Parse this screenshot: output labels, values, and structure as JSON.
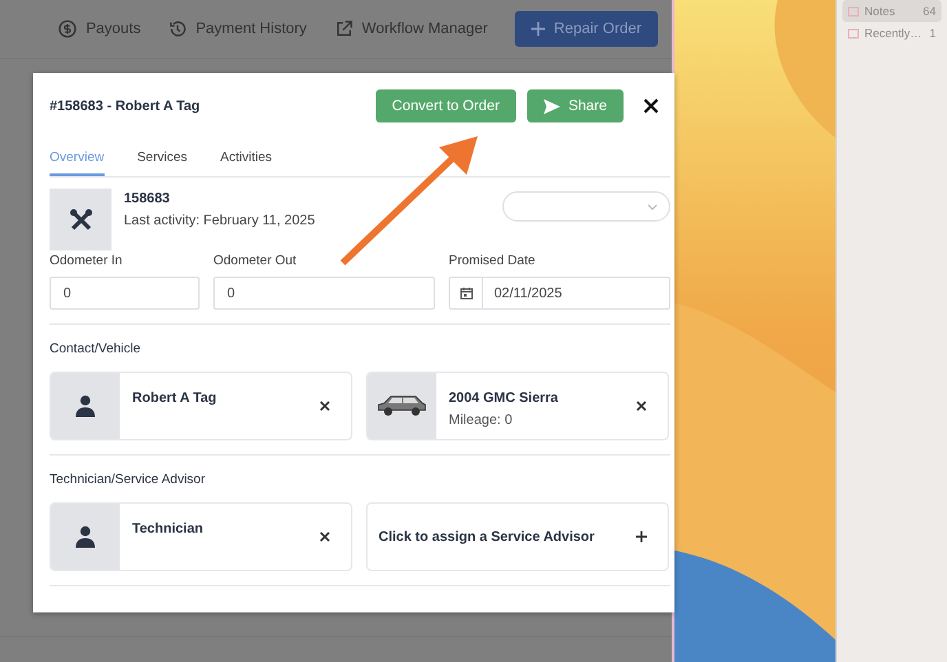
{
  "toolbar": {
    "links": [
      {
        "label": "Payouts"
      },
      {
        "label": "Payment History"
      },
      {
        "label": "Workflow Manager"
      }
    ],
    "primary_button": "Repair Order"
  },
  "modal": {
    "title": "#158683 - Robert A Tag",
    "buttons": [
      {
        "label": "Convert to Order",
        "kind": "plain"
      },
      {
        "label": "Share",
        "kind": "send"
      }
    ],
    "tabs": [
      {
        "label": "Overview",
        "selected": true
      },
      {
        "label": "Services",
        "selected": false
      },
      {
        "label": "Activities",
        "selected": false
      }
    ],
    "record": {
      "number": "158683",
      "last_activity": "Last activity: February 11, 2025"
    },
    "fields": [
      {
        "label": "Odometer In",
        "value": "0",
        "kind": "text"
      },
      {
        "label": "Odometer Out",
        "value": "0",
        "kind": "text"
      },
      {
        "label": "Promised Date",
        "value": "02/11/2025",
        "kind": "date"
      }
    ],
    "sections": [
      {
        "title": "Contact/Vehicle",
        "cards": [
          {
            "kind": "person",
            "name": "Robert A Tag"
          },
          {
            "kind": "vehicle",
            "name": "2004 GMC Sierra",
            "subtitle": "Mileage: 0"
          }
        ]
      },
      {
        "title": "Technician/Service Advisor",
        "cards": [
          {
            "kind": "person",
            "name": "Technician"
          },
          {
            "kind": "assign",
            "name": "Click to assign a Service Advisor"
          }
        ]
      }
    ]
  },
  "notes_sidebar": {
    "items": [
      {
        "label": "Notes",
        "count": "64",
        "selected": true
      },
      {
        "label": "Recently…",
        "count": "1",
        "selected": false
      }
    ]
  }
}
